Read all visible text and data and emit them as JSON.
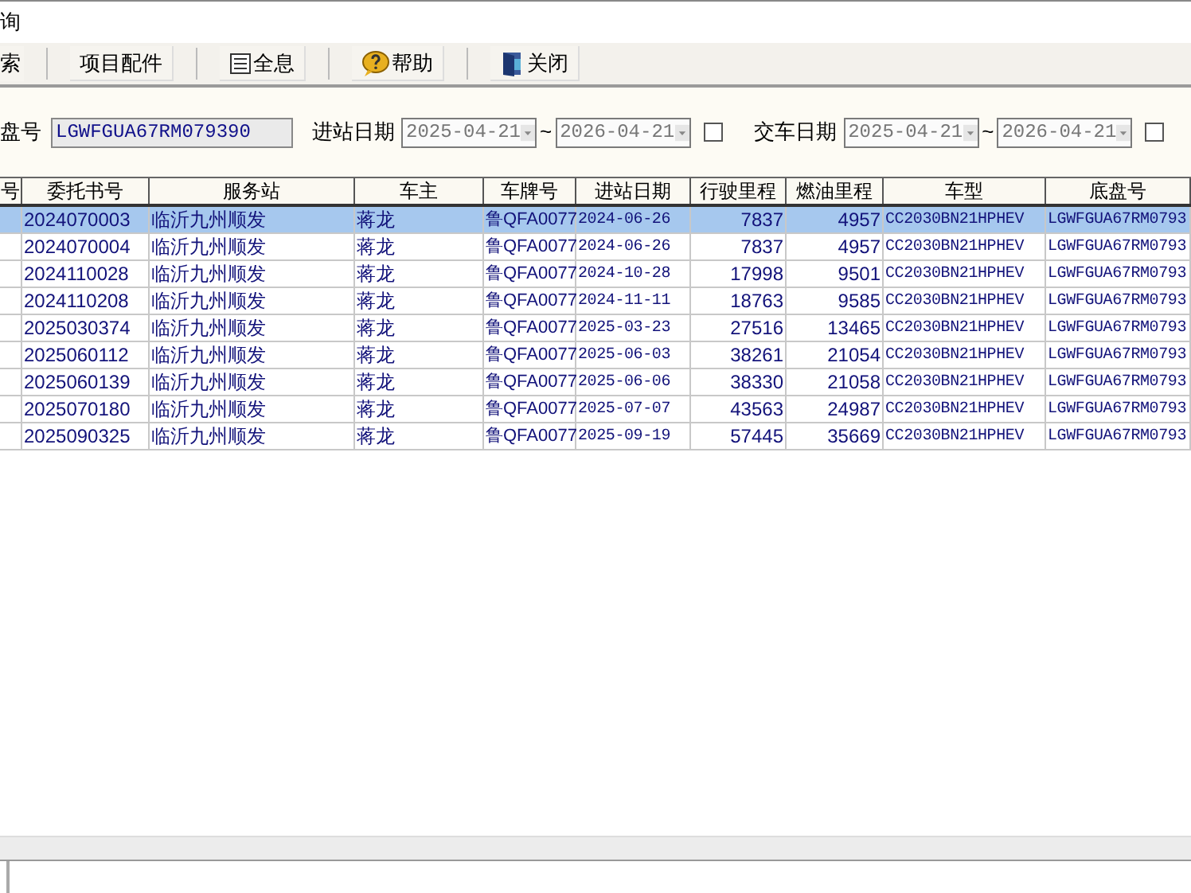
{
  "window": {
    "title": "询"
  },
  "toolbar": [
    {
      "label": "索"
    },
    {
      "label": "项目配件"
    },
    {
      "label": "全息"
    },
    {
      "label": "帮助"
    },
    {
      "label": "关闭"
    }
  ],
  "filters": {
    "chassis_label": "盘号",
    "chassis_value": "LGWFGUA67RM079390",
    "groups": [
      {
        "label": "进站日期",
        "from": {
          "value": "2025-04-21",
          "disabled": true
        },
        "separator": "~",
        "to": {
          "value": "2026-04-21",
          "disabled": true
        },
        "checked": false
      },
      {
        "label": "交车日期",
        "from": {
          "value": "2025-04-21",
          "disabled": true
        },
        "separator": "~",
        "to": {
          "value": "2026-04-21",
          "disabled": true
        },
        "checked": false
      }
    ]
  },
  "table": {
    "columns": [
      {
        "label": "号"
      },
      {
        "label": "委托书号"
      },
      {
        "label": "服务站"
      },
      {
        "label": "车主"
      },
      {
        "label": "车牌号"
      },
      {
        "label": "进站日期"
      },
      {
        "label": "行驶里程"
      },
      {
        "label": "燃油里程"
      },
      {
        "label": "车型"
      },
      {
        "label": "底盘号"
      }
    ],
    "rows": [
      {
        "selected": true,
        "cells": [
          "",
          "2024070003",
          "临沂九州顺发",
          "蒋龙",
          "鲁QFA0077",
          "2024-06-26",
          "7837",
          "4957",
          "CC2030BN21HPHEV",
          "LGWFGUA67RM0793"
        ]
      },
      {
        "selected": false,
        "cells": [
          "",
          "2024070004",
          "临沂九州顺发",
          "蒋龙",
          "鲁QFA0077",
          "2024-06-26",
          "7837",
          "4957",
          "CC2030BN21HPHEV",
          "LGWFGUA67RM0793"
        ]
      },
      {
        "selected": false,
        "cells": [
          "",
          "2024110028",
          "临沂九州顺发",
          "蒋龙",
          "鲁QFA0077",
          "2024-10-28",
          "17998",
          "9501",
          "CC2030BN21HPHEV",
          "LGWFGUA67RM0793"
        ]
      },
      {
        "selected": false,
        "cells": [
          "",
          "2024110208",
          "临沂九州顺发",
          "蒋龙",
          "鲁QFA0077",
          "2024-11-11",
          "18763",
          "9585",
          "CC2030BN21HPHEV",
          "LGWFGUA67RM0793"
        ]
      },
      {
        "selected": false,
        "cells": [
          "",
          "2025030374",
          "临沂九州顺发",
          "蒋龙",
          "鲁QFA0077",
          "2025-03-23",
          "27516",
          "13465",
          "CC2030BN21HPHEV",
          "LGWFGUA67RM0793"
        ]
      },
      {
        "selected": false,
        "cells": [
          "",
          "2025060112",
          "临沂九州顺发",
          "蒋龙",
          "鲁QFA0077",
          "2025-06-03",
          "38261",
          "21054",
          "CC2030BN21HPHEV",
          "LGWFGUA67RM0793"
        ]
      },
      {
        "selected": false,
        "cells": [
          "",
          "2025060139",
          "临沂九州顺发",
          "蒋龙",
          "鲁QFA0077",
          "2025-06-06",
          "38330",
          "21058",
          "CC2030BN21HPHEV",
          "LGWFGUA67RM0793"
        ]
      },
      {
        "selected": false,
        "cells": [
          "",
          "2025070180",
          "临沂九州顺发",
          "蒋龙",
          "鲁QFA0077",
          "2025-07-07",
          "43563",
          "24987",
          "CC2030BN21HPHEV",
          "LGWFGUA67RM0793"
        ]
      },
      {
        "selected": false,
        "cells": [
          "",
          "2025090325",
          "临沂九州顺发",
          "蒋龙",
          "鲁QFA0077",
          "2025-09-19",
          "57445",
          "35669",
          "CC2030BN21HPHEV",
          "LGWFGUA67RM0793"
        ]
      }
    ]
  }
}
